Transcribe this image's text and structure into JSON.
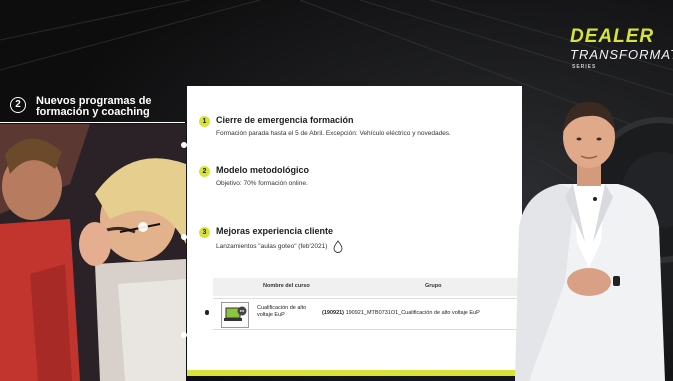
{
  "brand": {
    "name": "DEALER",
    "subtitle": "TRANSFORMATION",
    "series": "SERIES",
    "accent": "#d6e33b"
  },
  "section": {
    "number": "2",
    "title": "Nuevos programas de formación y coaching"
  },
  "items": [
    {
      "number": "1",
      "title": "Cierre de emergencia formación",
      "desc": "Formación parada hasta el 5 de Abril. Excepción: Vehículo eléctrico y novedades."
    },
    {
      "number": "2",
      "title": "Modelo metodológico",
      "desc": "Objetivo: 70% formación online."
    },
    {
      "number": "3",
      "title": "Mejoras experiencia cliente",
      "desc": "Lanzamientos \"aulas goteo\" (feb'2021)",
      "icon": "water-drop-icon"
    }
  ],
  "table": {
    "headers": [
      "Nombre del curso",
      "Grupo"
    ],
    "row": {
      "course": "Cualificación de alto voltaje EuP",
      "group_code": "(190921)",
      "group": "190921_MTB0731O1_Cualificación de alto voltaje EuP",
      "icon": "laptop-chat-icon"
    }
  }
}
